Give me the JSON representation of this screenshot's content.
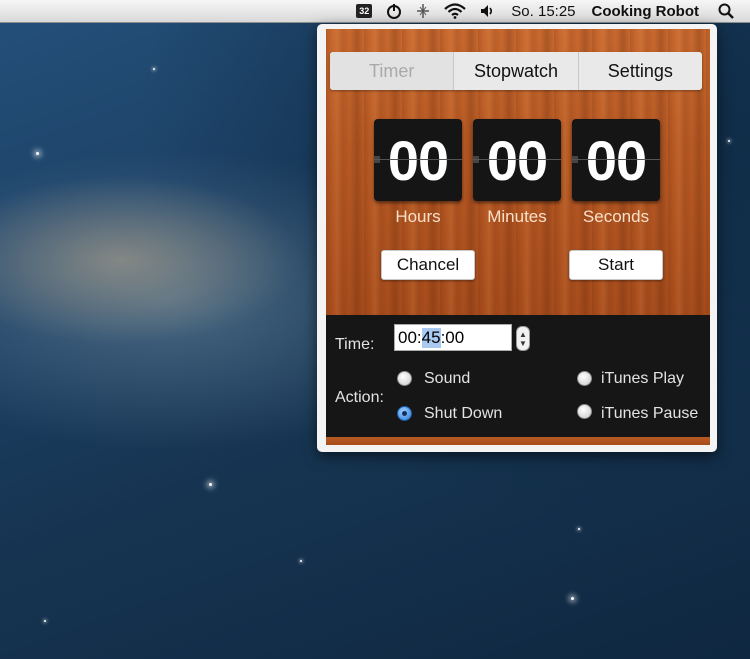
{
  "menubar": {
    "calendar_badge": "32",
    "icons": [
      "power-timer-icon",
      "bluetooth-icon",
      "wifi-icon",
      "volume-icon",
      "search-icon"
    ],
    "clock": "So. 15:25",
    "app_name": "Cooking Robot"
  },
  "tabs": [
    {
      "label": "Timer",
      "active": true
    },
    {
      "label": "Stopwatch",
      "active": false
    },
    {
      "label": "Settings",
      "active": false
    }
  ],
  "display": {
    "hours": "00",
    "minutes": "00",
    "seconds": "00",
    "hours_label": "Hours",
    "minutes_label": "Minutes",
    "seconds_label": "Seconds"
  },
  "buttons": {
    "cancel": "Chancel",
    "start": "Start"
  },
  "time": {
    "label": "Time:",
    "value_prefix": "00:",
    "value_selected": "45",
    "value_suffix": ":00"
  },
  "action": {
    "label": "Action:",
    "options": [
      {
        "label": "Sound",
        "selected": false
      },
      {
        "label": "Shut Down",
        "selected": true
      },
      {
        "label": "iTunes Play",
        "selected": false
      },
      {
        "label": "iTunes Pause",
        "selected": false
      }
    ]
  },
  "colors": {
    "wood": "#b85a24",
    "dark_panel": "#161616",
    "selection": "#a9c9f2"
  }
}
